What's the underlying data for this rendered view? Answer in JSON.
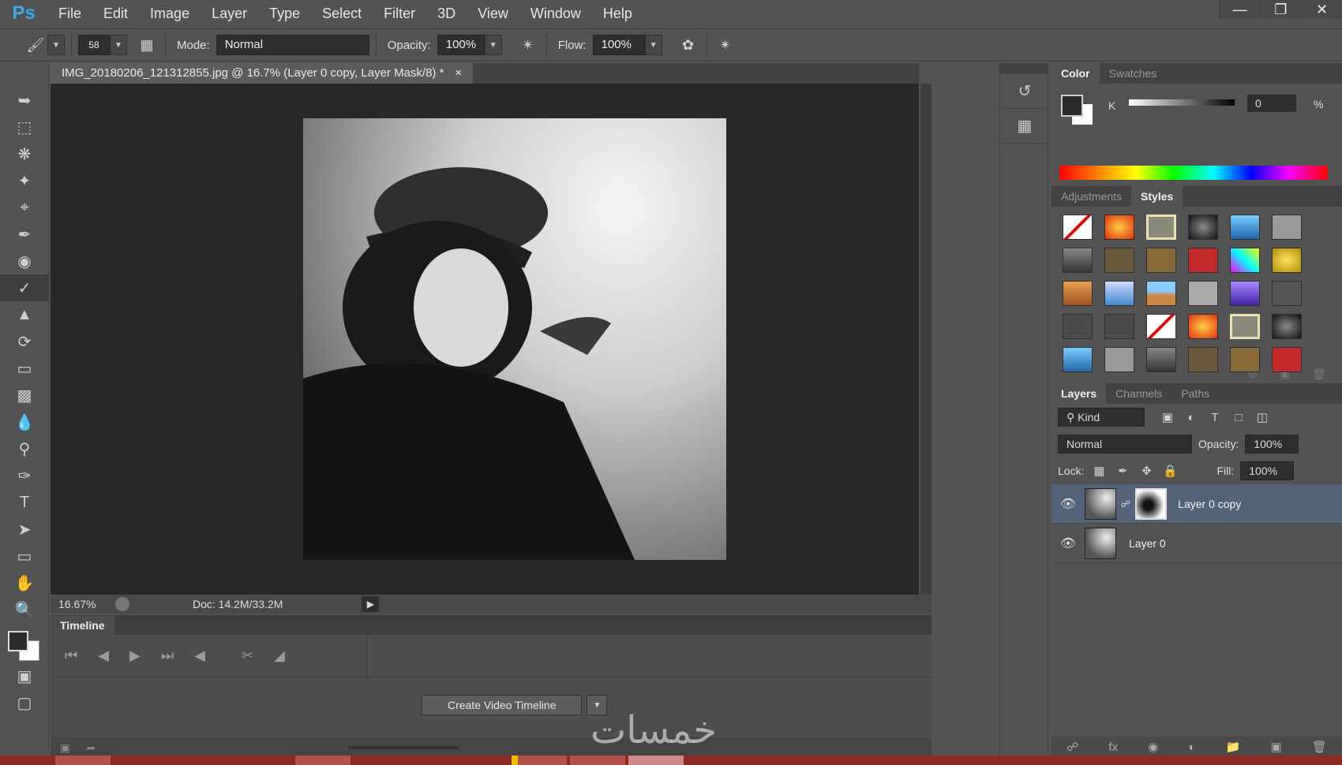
{
  "app": {
    "logo": "Ps"
  },
  "menu": [
    "File",
    "Edit",
    "Image",
    "Layer",
    "Type",
    "Select",
    "Filter",
    "3D",
    "View",
    "Window",
    "Help"
  ],
  "window_controls": [
    "minimize-icon",
    "restore-icon",
    "close-icon"
  ],
  "options": {
    "brush_size": "58",
    "mode_label": "Mode:",
    "mode_value": "Normal",
    "opacity_label": "Opacity:",
    "opacity_value": "100%",
    "flow_label": "Flow:",
    "flow_value": "100%"
  },
  "document": {
    "tab_title": "IMG_20180206_121312855.jpg @ 16.7% (Layer 0 copy, Layer Mask/8) *",
    "close": "×",
    "zoom": "16.67%",
    "doc_size": "Doc: 14.2M/33.2M"
  },
  "timeline": {
    "tab": "Timeline",
    "create_button": "Create Video Timeline"
  },
  "color_panel": {
    "tabs": [
      "Color",
      "Swatches"
    ],
    "channel": "K",
    "value": "0",
    "unit": "%"
  },
  "styles_panel": {
    "tabs": [
      "Adjustments",
      "Styles"
    ]
  },
  "layers_panel": {
    "tabs": [
      "Layers",
      "Channels",
      "Paths"
    ],
    "kind": "Kind",
    "blend_mode": "Normal",
    "opacity_label": "Opacity:",
    "opacity_value": "100%",
    "lock_label": "Lock:",
    "fill_label": "Fill:",
    "fill_value": "100%",
    "layers": [
      {
        "name": "Layer 0 copy",
        "selected": true,
        "has_mask": true
      },
      {
        "name": "Layer 0",
        "selected": false,
        "has_mask": false
      }
    ]
  },
  "watermark": "خمسات",
  "colors": {
    "accent_logo": "#3ea8ee",
    "selected_layer": "#53637a",
    "taskbar": "#8a2a22"
  }
}
